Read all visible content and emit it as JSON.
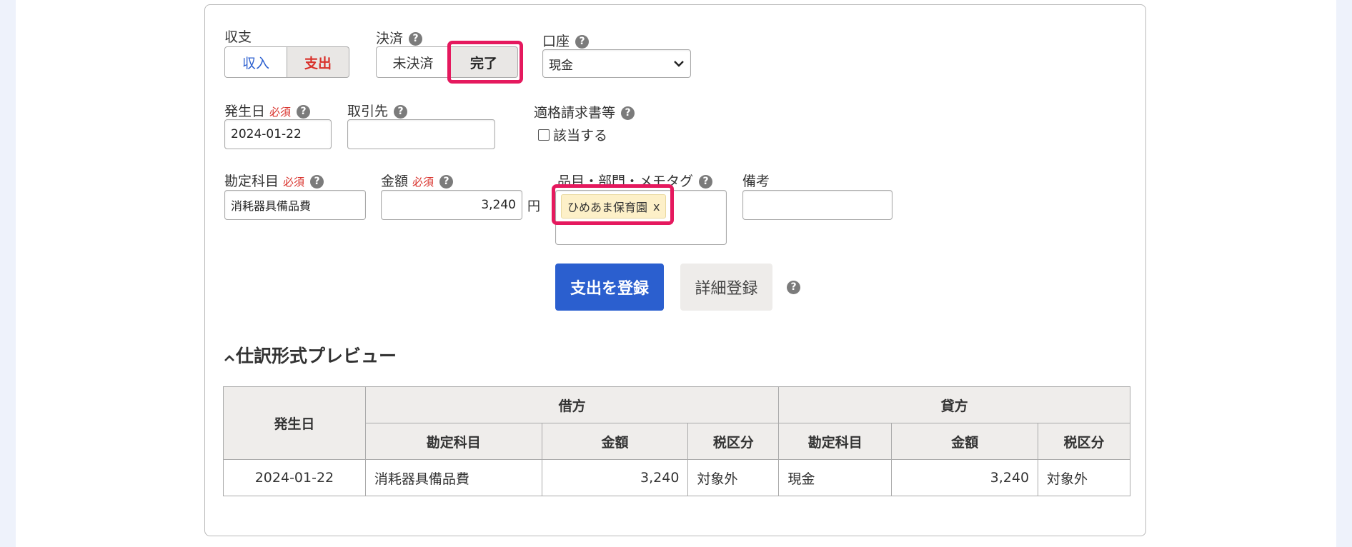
{
  "form": {
    "type_label": "収支",
    "type_income": "収入",
    "type_expense": "支出",
    "settlement_label": "決済",
    "settlement_unsettled": "未決済",
    "settlement_done": "完了",
    "account_label": "口座",
    "account_value": "現金",
    "date_label": "発生日",
    "date_value": "2024-01-22",
    "required": "必須",
    "partner_label": "取引先",
    "partner_value": "",
    "invoice_label": "適格請求書等",
    "invoice_checkbox_label": "該当する",
    "category_label": "勘定科目",
    "category_value": "消耗器具備品費",
    "amount_label": "金額",
    "amount_value": "3,240",
    "currency": "円",
    "tags_label": "品目・部門・メモタグ",
    "tag_chip": "ひめあま保育園",
    "tag_remove": "x",
    "memo_label": "備考",
    "memo_value": "",
    "help": "?"
  },
  "actions": {
    "register_expense": "支出を登録",
    "detailed_register": "詳細登録"
  },
  "preview": {
    "toggle_icon": "chevron-up-icon",
    "title": "仕訳形式プレビュー",
    "headers": {
      "date": "発生日",
      "debit": "借方",
      "credit": "貸方",
      "account": "勘定科目",
      "amount": "金額",
      "tax": "税区分"
    },
    "row": {
      "date": "2024-01-22",
      "debit_account": "消耗器具備品費",
      "debit_amount": "3,240",
      "debit_tax": "対象外",
      "credit_account": "現金",
      "credit_amount": "3,240",
      "credit_tax": "対象外"
    }
  },
  "colors": {
    "income": "#2b5fcf",
    "expense": "#d9322c",
    "highlight": "#e5195e",
    "primary_button": "#2b5fcf",
    "tag_chip_bg": "#fdf0c8"
  }
}
